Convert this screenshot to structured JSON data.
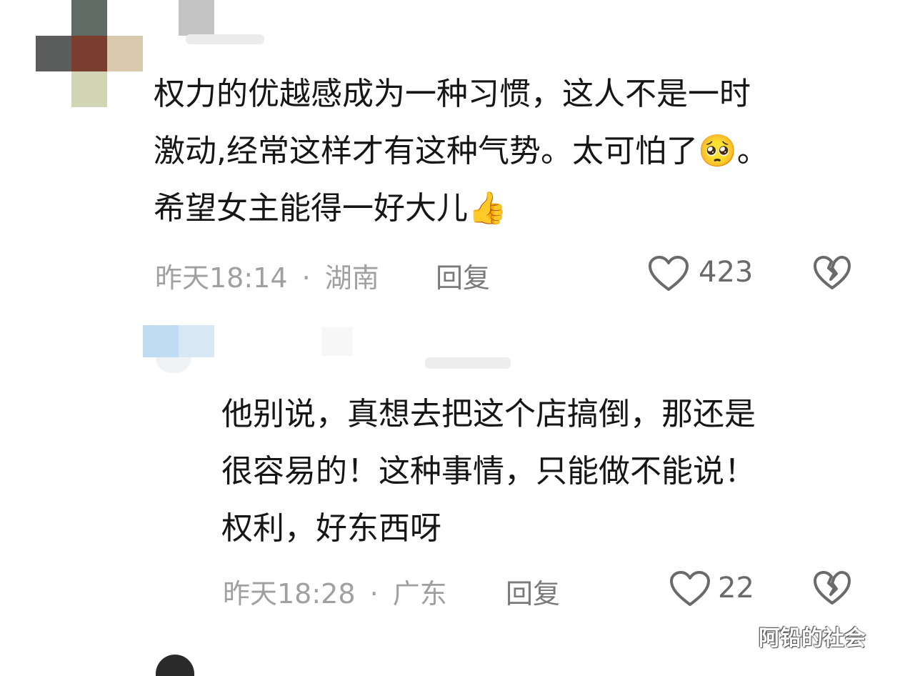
{
  "comments": [
    {
      "lines": [
        "权力的优越感成为一种习惯，这人不是一时",
        "激动,经常这样才有这种气势。太可怕了",
        "希望女主能得一好大儿"
      ],
      "emoji_line2": "🥺",
      "emoji_line2_suffix": "。",
      "emoji_line3": "👍",
      "time": "昨天18:14",
      "separator": "·",
      "location": "湖南",
      "reply_label": "回复",
      "likes": "423",
      "like_icon": "heart-outline-icon",
      "dislike_icon": "broken-heart-icon"
    },
    {
      "lines": [
        "他别说，真想去把这个店搞倒，那还是",
        "很容易的！这种事情，只能做不能说！",
        "权利，好东西呀"
      ],
      "time": "昨天18:28",
      "separator": "·",
      "location": "广东",
      "reply_label": "回复",
      "likes": "22",
      "like_icon": "heart-outline-icon",
      "dislike_icon": "broken-heart-icon"
    }
  ],
  "watermark": "阿铅的社会"
}
